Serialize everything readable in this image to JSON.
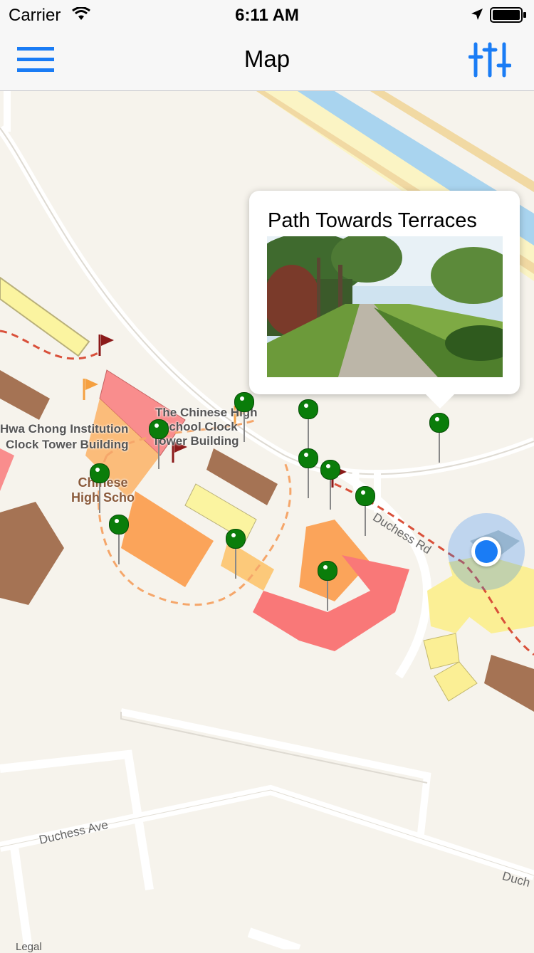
{
  "status_bar": {
    "carrier": "Carrier",
    "time": "6:11 AM"
  },
  "navbar": {
    "title": "Map",
    "menu_icon": "hamburger-menu-icon",
    "filter_icon": "sliders-filter-icon"
  },
  "map": {
    "place_labels": [
      {
        "text": "Hwa Chong Institution"
      },
      {
        "text": "Clock Tower Building"
      },
      {
        "text": "The Chinese High"
      },
      {
        "text": "School Clock"
      },
      {
        "text": "Tower Building"
      }
    ],
    "poi_label": {
      "line1": "Chinese",
      "line2": "High Scho"
    },
    "roads": {
      "duchess_rd": "Duchess Rd",
      "duchess_ave": "Duchess Ave",
      "duchess_edge": "Duch"
    },
    "legal": "Legal",
    "pin_color": "#0a7d0a",
    "user_location_color": "#1a7cf5"
  },
  "callout": {
    "title": "Path Towards Terraces"
  }
}
